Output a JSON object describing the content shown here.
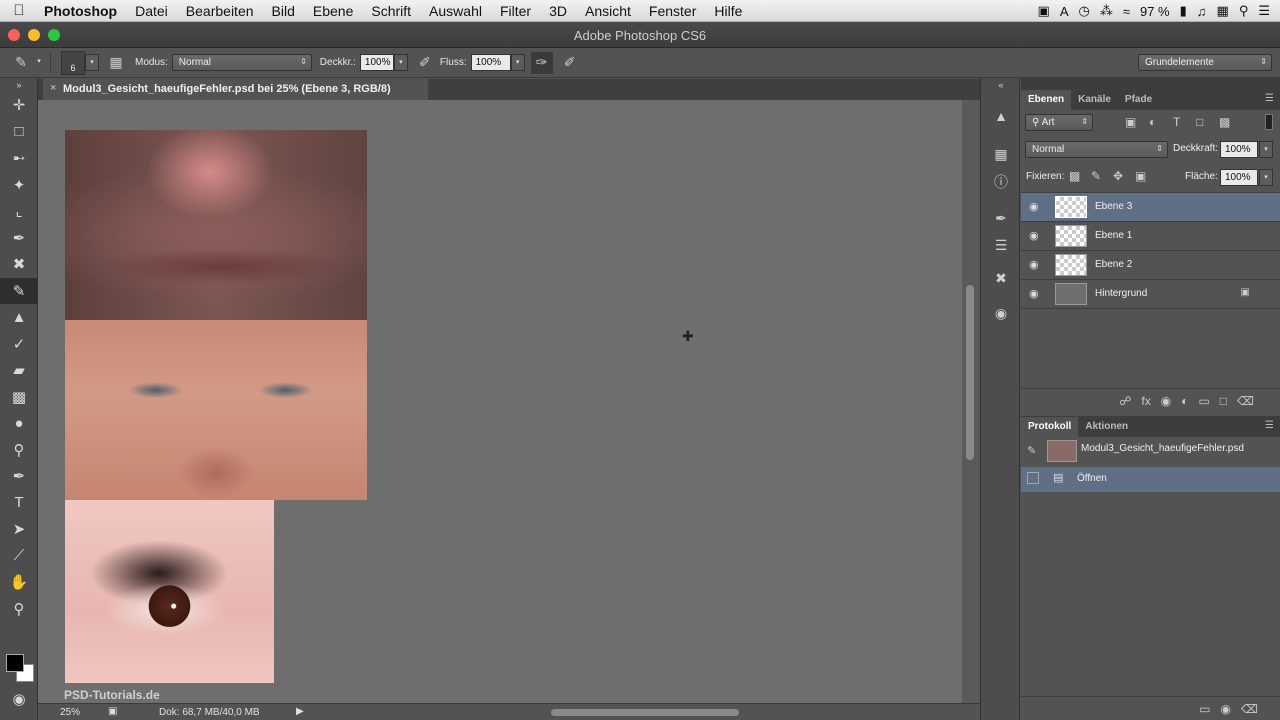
{
  "menubar": {
    "apple": "",
    "items": [
      "Photoshop",
      "Datei",
      "Bearbeiten",
      "Bild",
      "Ebene",
      "Schrift",
      "Auswahl",
      "Filter",
      "3D",
      "Ansicht",
      "Fenster",
      "Hilfe"
    ],
    "battery": "97 %"
  },
  "window": {
    "title": "Adobe Photoshop CS6"
  },
  "options": {
    "brush_size": "6",
    "mode_label": "Modus:",
    "mode_value": "Normal",
    "opacity_label": "Deckkr.:",
    "opacity_value": "100%",
    "flow_label": "Fluss:",
    "flow_value": "100%",
    "workspace": "Grundelemente"
  },
  "document": {
    "tab_title": "Modul3_Gesicht_haeufigeFehler.psd bei 25% (Ebene 3, RGB/8)"
  },
  "status": {
    "zoom": "25%",
    "doc_size": "Dok: 68,7 MB/40,0 MB",
    "watermark": "PSD-Tutorials.de"
  },
  "layers_panel": {
    "tabs": [
      "Ebenen",
      "Kanäle",
      "Pfade"
    ],
    "filter_label": "Art",
    "blend_mode": "Normal",
    "opacity_label": "Deckkraft:",
    "opacity_value": "100%",
    "lock_label": "Fixieren:",
    "fill_label": "Fläche:",
    "fill_value": "100%",
    "layers": [
      {
        "name": "Ebene 3",
        "selected": true
      },
      {
        "name": "Ebene 1",
        "selected": false
      },
      {
        "name": "Ebene 2",
        "selected": false
      },
      {
        "name": "Hintergrund",
        "selected": false,
        "locked": true
      }
    ]
  },
  "history_panel": {
    "tabs": [
      "Protokoll",
      "Aktionen"
    ],
    "snapshot": "Modul3_Gesicht_haeufigeFehler.psd",
    "steps": [
      "Öffnen"
    ]
  },
  "colors": {
    "selection": "#5f6f86",
    "canvas_bg": "#6e6e6e"
  }
}
